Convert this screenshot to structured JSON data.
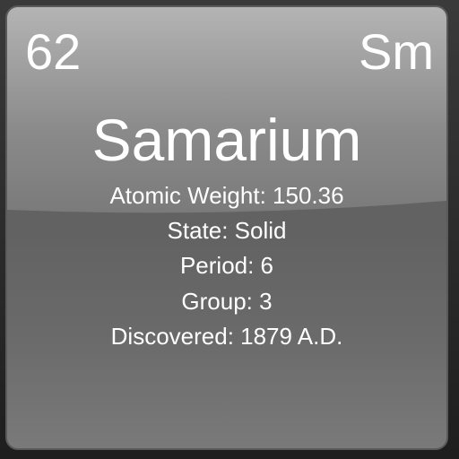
{
  "element": {
    "atomic_number": "62",
    "symbol": "Sm",
    "name": "Samarium",
    "details": {
      "atomic_weight": "Atomic Weight: 150.36",
      "state": "State: Solid",
      "period": "Period: 6",
      "group": "Group: 3",
      "discovered": "Discovered: 1879 A.D."
    }
  },
  "colors": {
    "text": "#ffffff",
    "tile_top": "#b4b4b4",
    "tile_bottom": "#606060",
    "background": "#2b2b2b"
  }
}
